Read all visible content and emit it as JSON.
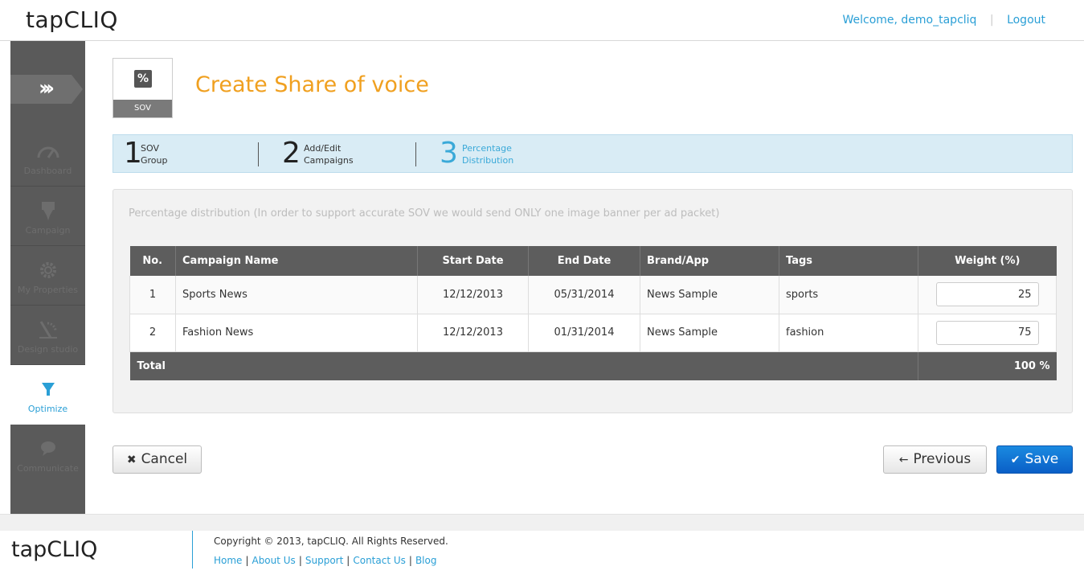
{
  "header": {
    "logo_bold": "tap",
    "logo_light": "CLIQ",
    "welcome": "Welcome, demo_tapcliq",
    "logout": "Logout"
  },
  "sidebar": {
    "items": [
      {
        "label": "Dashboard",
        "icon": "gauge-icon"
      },
      {
        "label": "Campaign",
        "icon": "campaign-icon"
      },
      {
        "label": "My Properties",
        "icon": "gear-icon"
      },
      {
        "label": "Design studio",
        "icon": "design-icon"
      },
      {
        "label": "Optimize",
        "icon": "filter-icon",
        "active": true
      },
      {
        "label": "Communicate",
        "icon": "chat-icon"
      }
    ]
  },
  "page": {
    "badge_symbol": "%",
    "badge_label": "SOV",
    "title": "Create Share of voice"
  },
  "steps": [
    {
      "num": "1",
      "line1": "SOV",
      "line2": "Group"
    },
    {
      "num": "2",
      "line1": "Add/Edit",
      "line2": "Campaigns"
    },
    {
      "num": "3",
      "line1": "Percentage",
      "line2": "Distribution"
    }
  ],
  "panel": {
    "note": "Percentage distribution (In order to support accurate SOV we would send ONLY one image banner per ad packet)"
  },
  "table": {
    "headers": [
      "No.",
      "Campaign Name",
      "Start Date",
      "End Date",
      "Brand/App",
      "Tags",
      "Weight (%)"
    ],
    "rows": [
      {
        "no": "1",
        "name": "Sports News",
        "start": "12/12/2013",
        "end": "05/31/2014",
        "brand": "News Sample",
        "tags": "sports",
        "weight": "25"
      },
      {
        "no": "2",
        "name": "Fashion News",
        "start": "12/12/2013",
        "end": "01/31/2014",
        "brand": "News Sample",
        "tags": "fashion",
        "weight": "75"
      }
    ],
    "total_label": "Total",
    "total_value": "100 %"
  },
  "buttons": {
    "cancel": "Cancel",
    "previous": "Previous",
    "save": "Save"
  },
  "footer": {
    "logo_bold": "tap",
    "logo_light": "CLIQ",
    "copyright": "Copyright © 2013, tapCLIQ. All Rights Reserved.",
    "links": [
      "Home",
      "About Us",
      "Support",
      "Contact Us",
      "Blog"
    ]
  },
  "colors": {
    "accent": "#2a9fd6",
    "title": "#f0a020",
    "sidebar": "#5a5a5a",
    "save": "#0a5fc7"
  }
}
